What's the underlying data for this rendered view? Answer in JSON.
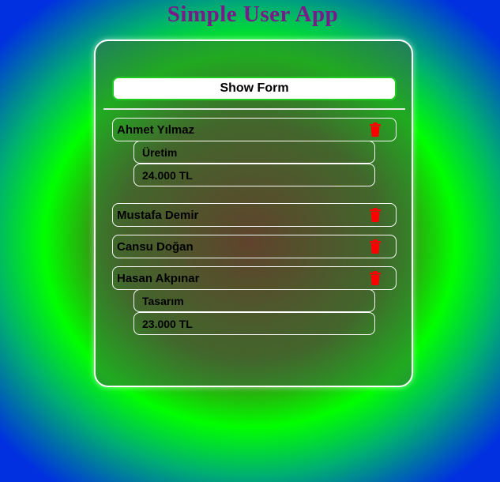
{
  "app": {
    "title": "Simple User App"
  },
  "form": {
    "toggle_label": "Show Form"
  },
  "users": [
    {
      "name": "Ahmet Yılmaz",
      "department": "Üretim",
      "salary": "24.000 TL",
      "expanded": true
    },
    {
      "name": "Mustafa Demir",
      "expanded": false
    },
    {
      "name": "Cansu Doğan",
      "expanded": false
    },
    {
      "name": "Hasan Akpınar",
      "department": "Tasarım",
      "salary": "23.000 TL",
      "expanded": true
    }
  ],
  "icons": {
    "delete": "trash-icon"
  },
  "colors": {
    "delete_icon": "#ff0000",
    "button_border": "#22cc22",
    "title": "#7a1a8a"
  }
}
